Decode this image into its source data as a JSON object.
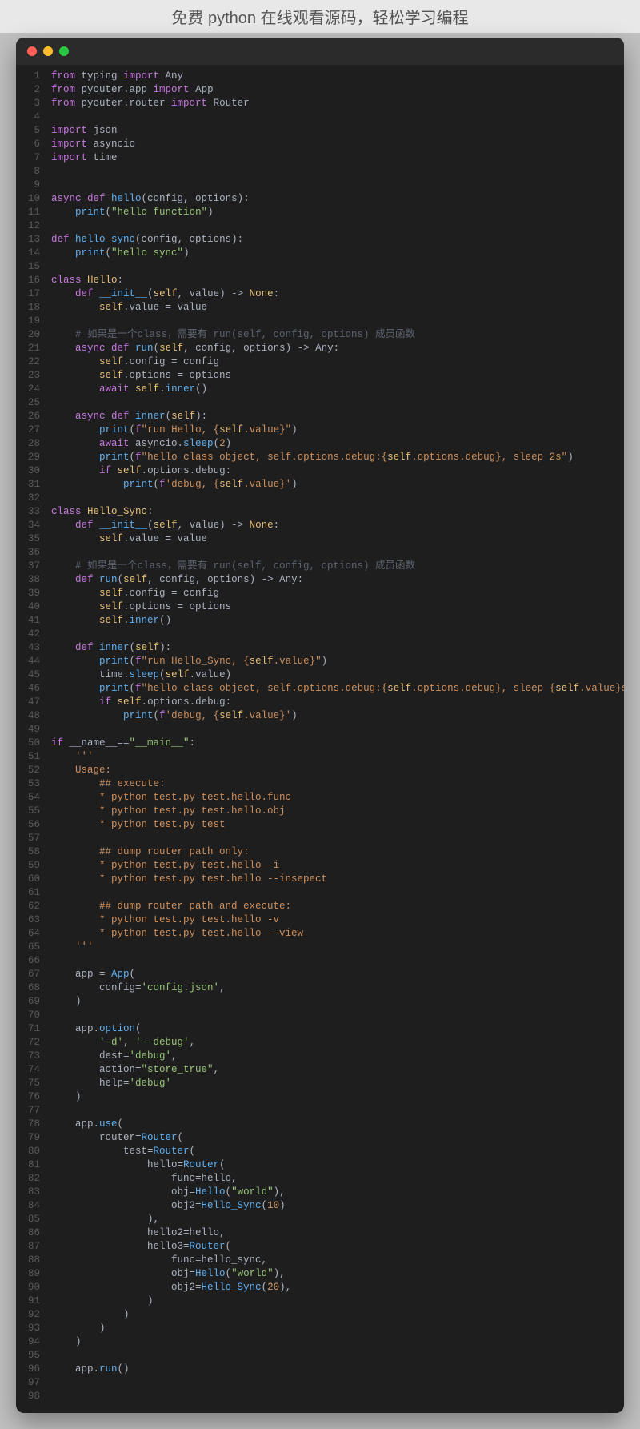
{
  "banner": "免费 python 在线观看源码，轻松学习编程",
  "code": {
    "lines": [
      [
        [
          "kw",
          "from"
        ],
        [
          "pl",
          " typing "
        ],
        [
          "kw",
          "import"
        ],
        [
          "pl",
          " Any"
        ]
      ],
      [
        [
          "kw",
          "from"
        ],
        [
          "pl",
          " pyouter.app "
        ],
        [
          "kw",
          "import"
        ],
        [
          "pl",
          " App"
        ]
      ],
      [
        [
          "kw",
          "from"
        ],
        [
          "pl",
          " pyouter.router "
        ],
        [
          "kw",
          "import"
        ],
        [
          "pl",
          " Router"
        ]
      ],
      [],
      [
        [
          "kw",
          "import"
        ],
        [
          "pl",
          " json"
        ]
      ],
      [
        [
          "kw",
          "import"
        ],
        [
          "pl",
          " asyncio"
        ]
      ],
      [
        [
          "kw",
          "import"
        ],
        [
          "pl",
          " time"
        ]
      ],
      [],
      [],
      [
        [
          "kw",
          "async def"
        ],
        [
          "pl",
          " "
        ],
        [
          "fn",
          "hello"
        ],
        [
          "pl",
          "(config, options):"
        ]
      ],
      [
        [
          "pl",
          "    "
        ],
        [
          "fn",
          "print"
        ],
        [
          "pl",
          "("
        ],
        [
          "str",
          "\"hello function\""
        ],
        [
          "pl",
          ")"
        ]
      ],
      [],
      [
        [
          "kw",
          "def"
        ],
        [
          "pl",
          " "
        ],
        [
          "fn",
          "hello_sync"
        ],
        [
          "pl",
          "(config, options):"
        ]
      ],
      [
        [
          "pl",
          "    "
        ],
        [
          "fn",
          "print"
        ],
        [
          "pl",
          "("
        ],
        [
          "str",
          "\"hello sync\""
        ],
        [
          "pl",
          ")"
        ]
      ],
      [],
      [
        [
          "kw",
          "class"
        ],
        [
          "pl",
          " "
        ],
        [
          "cls",
          "Hello"
        ],
        [
          "pl",
          ":"
        ]
      ],
      [
        [
          "pl",
          "    "
        ],
        [
          "kw",
          "def"
        ],
        [
          "pl",
          " "
        ],
        [
          "fn",
          "__init__"
        ],
        [
          "pl",
          "("
        ],
        [
          "self",
          "self"
        ],
        [
          "pl",
          ", value) -> "
        ],
        [
          "cls",
          "None"
        ],
        [
          "pl",
          ":"
        ]
      ],
      [
        [
          "pl",
          "        "
        ],
        [
          "self",
          "self"
        ],
        [
          "pl",
          ".value = value"
        ]
      ],
      [],
      [
        [
          "pl",
          "    "
        ],
        [
          "cmt",
          "# 如果是一个class，需要有 run(self, config, options) 成员函数"
        ]
      ],
      [
        [
          "pl",
          "    "
        ],
        [
          "kw",
          "async def"
        ],
        [
          "pl",
          " "
        ],
        [
          "fn",
          "run"
        ],
        [
          "pl",
          "("
        ],
        [
          "self",
          "self"
        ],
        [
          "pl",
          ", config, options) -> Any:"
        ]
      ],
      [
        [
          "pl",
          "        "
        ],
        [
          "self",
          "self"
        ],
        [
          "pl",
          ".config = config"
        ]
      ],
      [
        [
          "pl",
          "        "
        ],
        [
          "self",
          "self"
        ],
        [
          "pl",
          ".options = options"
        ]
      ],
      [
        [
          "pl",
          "        "
        ],
        [
          "kw",
          "await"
        ],
        [
          "pl",
          " "
        ],
        [
          "self",
          "self"
        ],
        [
          "pl",
          "."
        ],
        [
          "fn",
          "inner"
        ],
        [
          "pl",
          "()"
        ]
      ],
      [],
      [
        [
          "pl",
          "    "
        ],
        [
          "kw",
          "async def"
        ],
        [
          "pl",
          " "
        ],
        [
          "fn",
          "inner"
        ],
        [
          "pl",
          "("
        ],
        [
          "self",
          "self"
        ],
        [
          "pl",
          "):"
        ]
      ],
      [
        [
          "pl",
          "        "
        ],
        [
          "fn",
          "print"
        ],
        [
          "pl",
          "("
        ],
        [
          "kw",
          "f"
        ],
        [
          "fs",
          "\"run Hello, {"
        ],
        [
          "self",
          "self"
        ],
        [
          "fs",
          ".value}\""
        ],
        [
          "pl",
          ")"
        ]
      ],
      [
        [
          "pl",
          "        "
        ],
        [
          "kw",
          "await"
        ],
        [
          "pl",
          " asyncio."
        ],
        [
          "fn",
          "sleep"
        ],
        [
          "pl",
          "("
        ],
        [
          "num",
          "2"
        ],
        [
          "pl",
          ")"
        ]
      ],
      [
        [
          "pl",
          "        "
        ],
        [
          "fn",
          "print"
        ],
        [
          "pl",
          "("
        ],
        [
          "kw",
          "f"
        ],
        [
          "fs",
          "\"hello class object, self.options.debug:{"
        ],
        [
          "self",
          "self"
        ],
        [
          "fs",
          ".options.debug}, sleep 2s\""
        ],
        [
          "pl",
          ")"
        ]
      ],
      [
        [
          "pl",
          "        "
        ],
        [
          "kw",
          "if"
        ],
        [
          "pl",
          " "
        ],
        [
          "self",
          "self"
        ],
        [
          "pl",
          ".options.debug:"
        ]
      ],
      [
        [
          "pl",
          "            "
        ],
        [
          "fn",
          "print"
        ],
        [
          "pl",
          "("
        ],
        [
          "kw",
          "f"
        ],
        [
          "fs",
          "'debug, {"
        ],
        [
          "self",
          "self"
        ],
        [
          "fs",
          ".value}'"
        ],
        [
          "pl",
          ")"
        ]
      ],
      [],
      [
        [
          "kw",
          "class"
        ],
        [
          "pl",
          " "
        ],
        [
          "cls",
          "Hello_Sync"
        ],
        [
          "pl",
          ":"
        ]
      ],
      [
        [
          "pl",
          "    "
        ],
        [
          "kw",
          "def"
        ],
        [
          "pl",
          " "
        ],
        [
          "fn",
          "__init__"
        ],
        [
          "pl",
          "("
        ],
        [
          "self",
          "self"
        ],
        [
          "pl",
          ", value) -> "
        ],
        [
          "cls",
          "None"
        ],
        [
          "pl",
          ":"
        ]
      ],
      [
        [
          "pl",
          "        "
        ],
        [
          "self",
          "self"
        ],
        [
          "pl",
          ".value = value"
        ]
      ],
      [],
      [
        [
          "pl",
          "    "
        ],
        [
          "cmt",
          "# 如果是一个class，需要有 run(self, config, options) 成员函数"
        ]
      ],
      [
        [
          "pl",
          "    "
        ],
        [
          "kw",
          "def"
        ],
        [
          "pl",
          " "
        ],
        [
          "fn",
          "run"
        ],
        [
          "pl",
          "("
        ],
        [
          "self",
          "self"
        ],
        [
          "pl",
          ", config, options) -> Any:"
        ]
      ],
      [
        [
          "pl",
          "        "
        ],
        [
          "self",
          "self"
        ],
        [
          "pl",
          ".config = config"
        ]
      ],
      [
        [
          "pl",
          "        "
        ],
        [
          "self",
          "self"
        ],
        [
          "pl",
          ".options = options"
        ]
      ],
      [
        [
          "pl",
          "        "
        ],
        [
          "self",
          "self"
        ],
        [
          "pl",
          "."
        ],
        [
          "fn",
          "inner"
        ],
        [
          "pl",
          "()"
        ]
      ],
      [],
      [
        [
          "pl",
          "    "
        ],
        [
          "kw",
          "def"
        ],
        [
          "pl",
          " "
        ],
        [
          "fn",
          "inner"
        ],
        [
          "pl",
          "("
        ],
        [
          "self",
          "self"
        ],
        [
          "pl",
          "):"
        ]
      ],
      [
        [
          "pl",
          "        "
        ],
        [
          "fn",
          "print"
        ],
        [
          "pl",
          "("
        ],
        [
          "kw",
          "f"
        ],
        [
          "fs",
          "\"run Hello_Sync, {"
        ],
        [
          "self",
          "self"
        ],
        [
          "fs",
          ".value}\""
        ],
        [
          "pl",
          ")"
        ]
      ],
      [
        [
          "pl",
          "        time."
        ],
        [
          "fn",
          "sleep"
        ],
        [
          "pl",
          "("
        ],
        [
          "self",
          "self"
        ],
        [
          "pl",
          ".value)"
        ]
      ],
      [
        [
          "pl",
          "        "
        ],
        [
          "fn",
          "print"
        ],
        [
          "pl",
          "("
        ],
        [
          "kw",
          "f"
        ],
        [
          "fs",
          "\"hello class object, self.options.debug:{"
        ],
        [
          "self",
          "self"
        ],
        [
          "fs",
          ".options.debug}, sleep {"
        ],
        [
          "self",
          "self"
        ],
        [
          "fs",
          ".value}s\""
        ],
        [
          "pl",
          ")"
        ]
      ],
      [
        [
          "pl",
          "        "
        ],
        [
          "kw",
          "if"
        ],
        [
          "pl",
          " "
        ],
        [
          "self",
          "self"
        ],
        [
          "pl",
          ".options.debug:"
        ]
      ],
      [
        [
          "pl",
          "            "
        ],
        [
          "fn",
          "print"
        ],
        [
          "pl",
          "("
        ],
        [
          "kw",
          "f"
        ],
        [
          "fs",
          "'debug, {"
        ],
        [
          "self",
          "self"
        ],
        [
          "fs",
          ".value}'"
        ],
        [
          "pl",
          ")"
        ]
      ],
      [],
      [
        [
          "kw",
          "if"
        ],
        [
          "pl",
          " __name__=="
        ],
        [
          "str",
          "\"__main__\""
        ],
        [
          "pl",
          ":"
        ]
      ],
      [
        [
          "pl",
          "    "
        ],
        [
          "doc",
          "'''"
        ]
      ],
      [
        [
          "pl",
          "    "
        ],
        [
          "doc",
          "Usage:"
        ]
      ],
      [
        [
          "pl",
          "        "
        ],
        [
          "doc",
          "## execute:"
        ]
      ],
      [
        [
          "pl",
          "        "
        ],
        [
          "doc",
          "* python test.py test.hello.func"
        ]
      ],
      [
        [
          "pl",
          "        "
        ],
        [
          "doc",
          "* python test.py test.hello.obj"
        ]
      ],
      [
        [
          "pl",
          "        "
        ],
        [
          "doc",
          "* python test.py test"
        ]
      ],
      [
        [
          "doc",
          ""
        ]
      ],
      [
        [
          "pl",
          "        "
        ],
        [
          "doc",
          "## dump router path only:"
        ]
      ],
      [
        [
          "pl",
          "        "
        ],
        [
          "doc",
          "* python test.py test.hello -i"
        ]
      ],
      [
        [
          "pl",
          "        "
        ],
        [
          "doc",
          "* python test.py test.hello --insepect"
        ]
      ],
      [
        [
          "doc",
          ""
        ]
      ],
      [
        [
          "pl",
          "        "
        ],
        [
          "doc",
          "## dump router path and execute:"
        ]
      ],
      [
        [
          "pl",
          "        "
        ],
        [
          "doc",
          "* python test.py test.hello -v"
        ]
      ],
      [
        [
          "pl",
          "        "
        ],
        [
          "doc",
          "* python test.py test.hello --view"
        ]
      ],
      [
        [
          "pl",
          "    "
        ],
        [
          "doc",
          "'''"
        ]
      ],
      [],
      [
        [
          "pl",
          "    app = "
        ],
        [
          "fn",
          "App"
        ],
        [
          "pl",
          "("
        ]
      ],
      [
        [
          "pl",
          "        config="
        ],
        [
          "str",
          "'config.json'"
        ],
        [
          "pl",
          ","
        ]
      ],
      [
        [
          "pl",
          "    )"
        ]
      ],
      [],
      [
        [
          "pl",
          "    app."
        ],
        [
          "fn",
          "option"
        ],
        [
          "pl",
          "("
        ]
      ],
      [
        [
          "pl",
          "        "
        ],
        [
          "str",
          "'-d'"
        ],
        [
          "pl",
          ", "
        ],
        [
          "str",
          "'--debug'"
        ],
        [
          "pl",
          ","
        ]
      ],
      [
        [
          "pl",
          "        dest="
        ],
        [
          "str",
          "'debug'"
        ],
        [
          "pl",
          ","
        ]
      ],
      [
        [
          "pl",
          "        action="
        ],
        [
          "str",
          "\"store_true\""
        ],
        [
          "pl",
          ","
        ]
      ],
      [
        [
          "pl",
          "        help="
        ],
        [
          "str",
          "'debug'"
        ]
      ],
      [
        [
          "pl",
          "    )"
        ]
      ],
      [],
      [
        [
          "pl",
          "    app."
        ],
        [
          "fn",
          "use"
        ],
        [
          "pl",
          "("
        ]
      ],
      [
        [
          "pl",
          "        router="
        ],
        [
          "fn",
          "Router"
        ],
        [
          "pl",
          "("
        ]
      ],
      [
        [
          "pl",
          "            test="
        ],
        [
          "fn",
          "Router"
        ],
        [
          "pl",
          "("
        ]
      ],
      [
        [
          "pl",
          "                hello="
        ],
        [
          "fn",
          "Router"
        ],
        [
          "pl",
          "("
        ]
      ],
      [
        [
          "pl",
          "                    func=hello,"
        ]
      ],
      [
        [
          "pl",
          "                    obj="
        ],
        [
          "fn",
          "Hello"
        ],
        [
          "pl",
          "("
        ],
        [
          "str",
          "\"world\""
        ],
        [
          "pl",
          "),"
        ]
      ],
      [
        [
          "pl",
          "                    obj2="
        ],
        [
          "fn",
          "Hello_Sync"
        ],
        [
          "pl",
          "("
        ],
        [
          "num",
          "10"
        ],
        [
          "pl",
          ")"
        ]
      ],
      [
        [
          "pl",
          "                ),"
        ]
      ],
      [
        [
          "pl",
          "                hello2=hello,"
        ]
      ],
      [
        [
          "pl",
          "                hello3="
        ],
        [
          "fn",
          "Router"
        ],
        [
          "pl",
          "("
        ]
      ],
      [
        [
          "pl",
          "                    func=hello_sync,"
        ]
      ],
      [
        [
          "pl",
          "                    obj="
        ],
        [
          "fn",
          "Hello"
        ],
        [
          "pl",
          "("
        ],
        [
          "str",
          "\"world\""
        ],
        [
          "pl",
          "),"
        ]
      ],
      [
        [
          "pl",
          "                    obj2="
        ],
        [
          "fn",
          "Hello_Sync"
        ],
        [
          "pl",
          "("
        ],
        [
          "num",
          "20"
        ],
        [
          "pl",
          "),"
        ]
      ],
      [
        [
          "pl",
          "                )"
        ]
      ],
      [
        [
          "pl",
          "            )"
        ]
      ],
      [
        [
          "pl",
          "        )"
        ]
      ],
      [
        [
          "pl",
          "    )"
        ]
      ],
      [],
      [
        [
          "pl",
          "    app."
        ],
        [
          "fn",
          "run"
        ],
        [
          "pl",
          "()"
        ]
      ],
      [],
      []
    ]
  }
}
